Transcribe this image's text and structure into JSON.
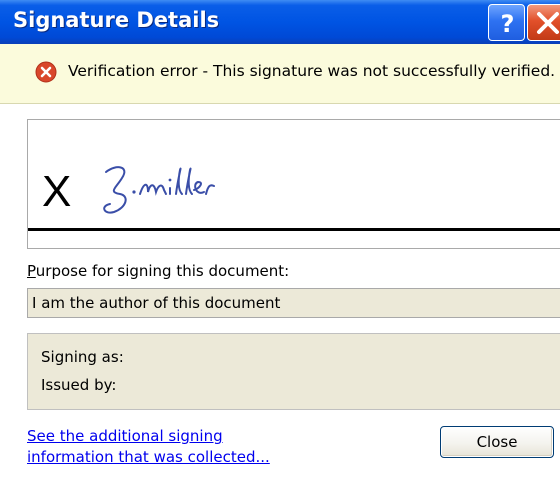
{
  "window": {
    "title": "Signature Details",
    "help_button": "?",
    "close_button": "✕"
  },
  "banner": {
    "icon": "error-icon",
    "message": "Verification error - This signature was not successfully verified."
  },
  "signature": {
    "mark": "X"
  },
  "purpose": {
    "label_accesskey": "P",
    "label_rest": "urpose for signing this document:",
    "value": "I am the author of this document"
  },
  "info": {
    "signing_as_label": "Signing as:",
    "issued_by_label": "Issued by:"
  },
  "footer": {
    "link_line1": "See the additional signing",
    "link_line2": "information that was collected...",
    "close_label": "Close"
  },
  "colors": {
    "titlebar": "#0054e3",
    "banner_bg": "#fbfbdc",
    "error_icon": "#d9472b",
    "link": "#0000ee"
  }
}
